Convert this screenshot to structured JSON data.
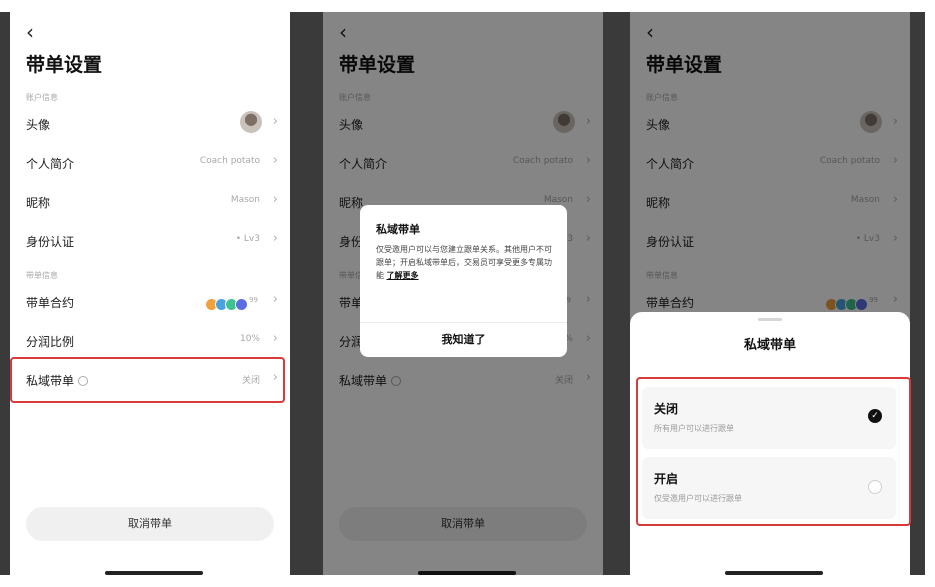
{
  "settings": {
    "back_icon": "‹",
    "title": "带单设置",
    "section_account": "账户信息",
    "section_lead": "带单信息",
    "rows": {
      "avatar": {
        "label": "头像"
      },
      "bio": {
        "label": "个人简介",
        "value": "Coach potato"
      },
      "nickname": {
        "label": "昵称",
        "value": "Mason"
      },
      "identity": {
        "label": "身份认证",
        "value": "• Lv3"
      },
      "contract": {
        "label": "带单合约",
        "more": "99"
      },
      "ratio": {
        "label": "分润比例",
        "value": "10%"
      },
      "private": {
        "label": "私域带单",
        "value": "关闭"
      }
    },
    "chevron": "›",
    "cancel_button": "取消带单"
  },
  "colors": {
    "highlight": "#d83a3a",
    "coins": [
      "#f0a03c",
      "#4aa3df",
      "#3ec28f",
      "#5b6ee1"
    ]
  },
  "dialog": {
    "title": "私域带单",
    "body": "仅受邀用户可以与您建立跟单关系。其他用户不可跟单；开启私域带单后，交易员可享受更多专属功能",
    "link": "了解更多",
    "button": "我知道了"
  },
  "sheet": {
    "title": "私域带单",
    "options": [
      {
        "title": "关闭",
        "subtitle": "所有用户可以进行跟单",
        "selected": true
      },
      {
        "title": "开启",
        "subtitle": "仅受邀用户可以进行跟单",
        "selected": false
      }
    ]
  }
}
